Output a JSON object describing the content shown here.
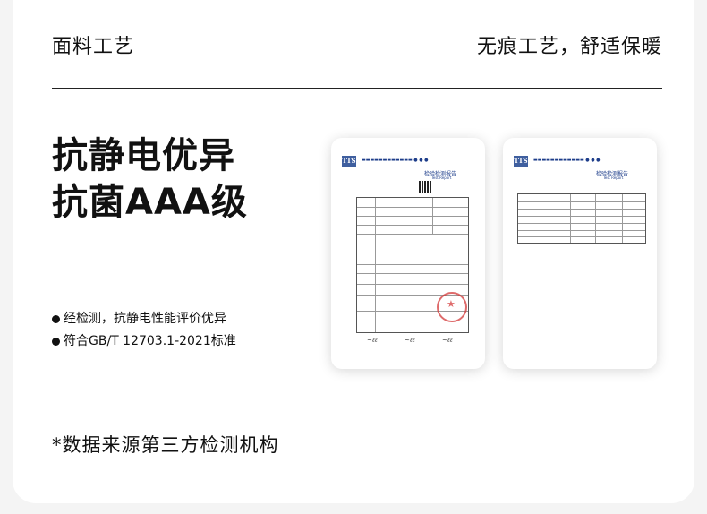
{
  "header": {
    "left": "面料工艺",
    "right": "无痕工艺，舒适保暖"
  },
  "headline": {
    "line1": "抗静电优异",
    "line2": "抗菌AAA级"
  },
  "bullets": [
    "经检测，抗静电性能评价优异",
    "符合GB/T 12703.1-2021标准"
  ],
  "footnote": "*数据来源第三方检测机构",
  "reports": {
    "logo_text": "TTS",
    "title": "检验检测报告",
    "subtitle": "Test Report"
  },
  "colors": {
    "text": "#111111",
    "card": "#ffffff",
    "background": "#f4f4f4",
    "report_blue": "#1d3d8a",
    "seal_red": "#d43a3a"
  }
}
